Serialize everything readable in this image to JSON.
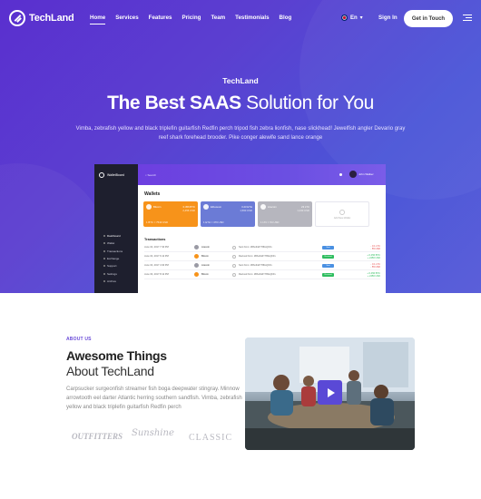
{
  "nav": {
    "brand": "TechLand",
    "menu": [
      "Home",
      "Services",
      "Features",
      "Pricing",
      "Team",
      "Testimonials",
      "Blog"
    ],
    "language": "En",
    "signin": "Sign In",
    "cta": "Get in Touch"
  },
  "hero": {
    "brand": "TechLand",
    "title_bold": "The Best SAAS",
    "title_rest": " Solution for You",
    "description": "Vimba, zebrafish yellow and black triplefin guitarfish Redfin perch tripod fish zebra lionfish, nase slickhead! Jewelfish angler Devario gray reef shark forehead brooder. Pike conger alewife sand lance orange"
  },
  "dashboard": {
    "app_name": "WalletBoard",
    "search_placeholder": "Search",
    "user_name": "John Walker",
    "sidebar": [
      "Dashboard",
      "Wallet",
      "Transactions",
      "Exchange",
      "Support",
      "Settings",
      "Archive"
    ],
    "wallets_title": "Wallets",
    "wallets": [
      {
        "name": "Bitcoin",
        "ticker": "BTC",
        "amount": "0.456 BTC",
        "usd": "2,456 USD",
        "footer": "1 BTC = 7543 USD",
        "color": "#f7931a"
      },
      {
        "name": "Ethereum",
        "ticker": "ETH",
        "amount": "3.23 ETH",
        "usd": "1,560 USD",
        "footer": "1 ETH = 476 USD",
        "color": "#6b7bd6"
      },
      {
        "name": "Litecoin",
        "ticker": "LTC",
        "amount": "23 LTC",
        "usd": "1,230 USD",
        "footer": "1 LTC = 54 USD",
        "color": "#b6b6be"
      }
    ],
    "add_wallet": "Add New Wallet",
    "transactions_title": "Transactions",
    "transactions": [
      {
        "date": "June 04, 2017 7:30 PM",
        "coin": "Litecoin",
        "coin_color": "#9a9aa4",
        "from": "Sent from: 1Bho34dY78bsQhFx",
        "status": "Sent",
        "status_color": "#4a90e2",
        "value": "- 0.1 LTC",
        "usd": "- 55 USD",
        "positive": false
      },
      {
        "date": "June 04, 2017 6:12 PM",
        "coin": "Bitcoin",
        "coin_color": "#f7931a",
        "from": "Recived from: 1Bho34dY78bsQhFx",
        "status": "Received",
        "status_color": "#2ebd5f",
        "value": "+ 0.456 BTC",
        "usd": "+ 2456 USD",
        "positive": true
      },
      {
        "date": "June 04, 2017 4:30 PM",
        "coin": "Litecoin",
        "coin_color": "#9a9aa4",
        "from": "Sent from: 1Bho34dY78bsQhFx",
        "status": "Sent",
        "status_color": "#4a90e2",
        "value": "- 0.1 LTC",
        "usd": "- 55 USD",
        "positive": false
      },
      {
        "date": "June 03, 2017 8:12 PM",
        "coin": "Bitcoin",
        "coin_color": "#f7931a",
        "from": "Recived from: 1Bho34dY78bsQhFx",
        "status": "Received",
        "status_color": "#2ebd5f",
        "value": "+ 0.456 BTC",
        "usd": "+ 2456 USD",
        "positive": true
      }
    ]
  },
  "about": {
    "label": "ABOUT US",
    "title_line1": "Awesome Things",
    "title_line2": "About TechLand",
    "description": "Carpsucker surgeonfish streamer fish boga deepwater stingray. Minnow arrowtooth eel darter Atlantic herring southern sandfish. Vimba, zebrafish yellow and black triplefin guitarfish Redfin perch",
    "brands": [
      "OUTFITTERS",
      "Sunshine",
      "CLASSIC"
    ]
  },
  "colors": {
    "accent": "#5a49d6",
    "hero_start": "#5a2fcf",
    "hero_end": "#5b5fd9"
  }
}
